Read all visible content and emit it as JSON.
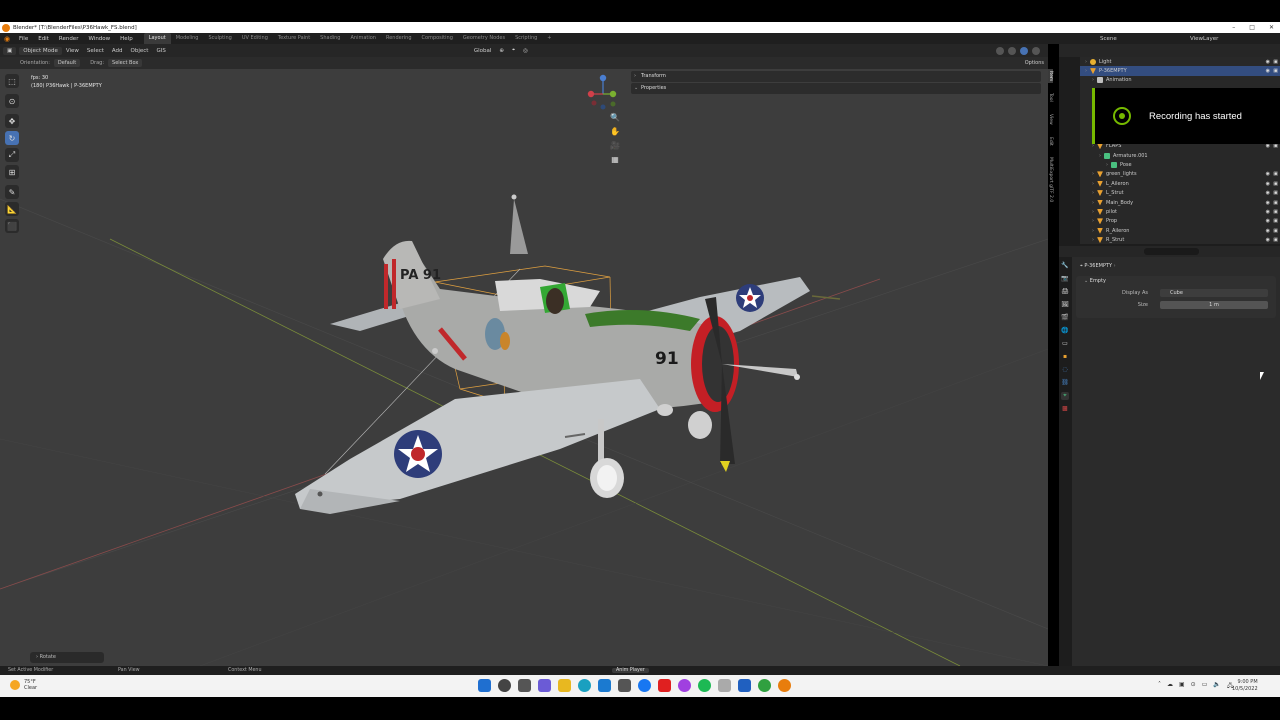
{
  "window": {
    "title": "Blender* [T:\\BlenderFiles\\P36Hawk_FS.blend]"
  },
  "menubar": {
    "menus": [
      "File",
      "Edit",
      "Render",
      "Window",
      "Help"
    ],
    "workspaces": [
      "Layout",
      "Modeling",
      "Sculpting",
      "UV Editing",
      "Texture Paint",
      "Shading",
      "Animation",
      "Rendering",
      "Compositing",
      "Geometry Nodes",
      "Scripting"
    ],
    "add_workspace": "+",
    "scene_label": "Scene",
    "viewlayer_label": "ViewLayer"
  },
  "viewport_header": {
    "mode": "Object Mode",
    "menus": [
      "View",
      "Select",
      "Add",
      "Object",
      "GIS"
    ],
    "transform_orientation": "Global"
  },
  "tool_settings": {
    "orientation_label": "Orientation:",
    "orientation_value": "Default",
    "drag_label": "Drag:",
    "drag_value": "Select Box",
    "options_label": "Options"
  },
  "viewport": {
    "fps_text": "fps: 30",
    "object_info": "(180) P36Hawk | P-36EMPTY",
    "redo_panel": "Rotate",
    "npanel": {
      "transform": "Transform",
      "properties": "Properties"
    },
    "side_tabs": [
      "Item",
      "Tool",
      "View",
      "Edit",
      "MultiExport glTF 2.0"
    ],
    "aircraft_markings": {
      "tail": "PA 91",
      "fuselage": "91"
    }
  },
  "outliner": {
    "rows": [
      {
        "name": "Light",
        "indent": 0,
        "icon": "light",
        "selected": false
      },
      {
        "name": "P-36EMPTY",
        "indent": 0,
        "icon": "empty",
        "selected": true
      },
      {
        "name": "Animation",
        "indent": 1,
        "icon": "anim",
        "selected": false
      },
      {
        "name": "",
        "indent": 1,
        "icon": "",
        "selected": false
      },
      {
        "name": "",
        "indent": 1,
        "icon": "",
        "selected": false
      },
      {
        "name": "",
        "indent": 1,
        "icon": "",
        "selected": false
      },
      {
        "name": "",
        "indent": 1,
        "icon": "",
        "selected": false
      },
      {
        "name": "",
        "indent": 1,
        "icon": "",
        "selected": false
      },
      {
        "name": "",
        "indent": 1,
        "icon": "",
        "selected": false
      },
      {
        "name": "FLAPS",
        "indent": 1,
        "icon": "mesh",
        "selected": false
      },
      {
        "name": "Armature.001",
        "indent": 2,
        "icon": "armature",
        "selected": false
      },
      {
        "name": "Pose",
        "indent": 3,
        "icon": "pose",
        "selected": false
      },
      {
        "name": "green_lights",
        "indent": 1,
        "icon": "mesh",
        "selected": false
      },
      {
        "name": "L_Aileron",
        "indent": 1,
        "icon": "mesh",
        "selected": false
      },
      {
        "name": "L_Strut",
        "indent": 1,
        "icon": "mesh",
        "selected": false
      },
      {
        "name": "Main_Body",
        "indent": 1,
        "icon": "mesh",
        "selected": false
      },
      {
        "name": "pilot",
        "indent": 1,
        "icon": "mesh",
        "selected": false
      },
      {
        "name": "Prop",
        "indent": 1,
        "icon": "mesh",
        "selected": false
      },
      {
        "name": "R_Aileron",
        "indent": 1,
        "icon": "mesh",
        "selected": false
      },
      {
        "name": "R_Strut",
        "indent": 1,
        "icon": "mesh",
        "selected": false
      }
    ]
  },
  "notification": {
    "message": "Recording has started",
    "accent": "#76b900"
  },
  "properties": {
    "breadcrumb": "P-36EMPTY",
    "panel_title": "Empty",
    "display_as_label": "Display As",
    "display_as_value": "Cube",
    "size_label": "Size",
    "size_value": "1 m"
  },
  "statusbar": {
    "left": "Set Active Modifier",
    "mid1": "Pan View",
    "mid2": "Context Menu",
    "center": "Anim Player"
  },
  "taskbar": {
    "temperature": "75°F",
    "condition": "Clear",
    "time": "9:00 PM",
    "date": "10/5/2022"
  },
  "colors": {
    "accent_blue": "#4772b3",
    "selection": "#334d80",
    "blender_orange": "#e87d0d"
  }
}
